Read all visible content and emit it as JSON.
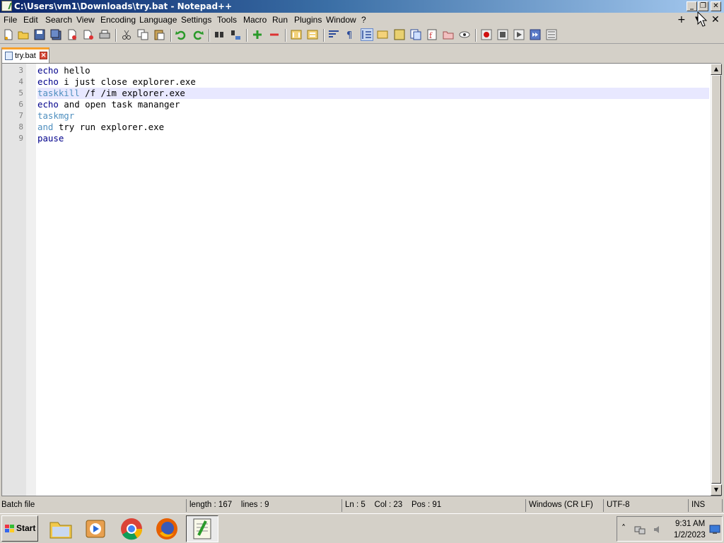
{
  "window": {
    "title": "C:\\Users\\vm1\\Downloads\\try.bat - Notepad++",
    "minimize_label": "_",
    "restore_label": "❐",
    "close_label": "✕"
  },
  "menu": {
    "items": [
      "File",
      "Edit",
      "Search",
      "View",
      "Encoding",
      "Language",
      "Settings",
      "Tools",
      "Macro",
      "Run",
      "Plugins",
      "Window",
      "?"
    ],
    "plus_label": "+",
    "dropdown_label": "▼",
    "close_label": "✕"
  },
  "tab": {
    "label": "try.bat",
    "close_label": "✕"
  },
  "editor": {
    "lines": [
      {
        "num": "3",
        "segments": [
          {
            "t": "echo",
            "c": "kw"
          },
          {
            "t": " hello",
            "c": ""
          }
        ]
      },
      {
        "num": "4",
        "segments": [
          {
            "t": "echo",
            "c": "kw"
          },
          {
            "t": " i just close explorer.exe",
            "c": ""
          }
        ]
      },
      {
        "num": "5",
        "current": true,
        "segments": [
          {
            "t": "taskkill",
            "c": "cmd"
          },
          {
            "t": " /f /im explorer.exe",
            "c": ""
          }
        ]
      },
      {
        "num": "6",
        "segments": [
          {
            "t": "echo",
            "c": "kw"
          },
          {
            "t": " and open task mananger",
            "c": ""
          }
        ]
      },
      {
        "num": "7",
        "segments": [
          {
            "t": "taskmgr",
            "c": "cmd"
          }
        ]
      },
      {
        "num": "8",
        "segments": [
          {
            "t": "and",
            "c": "cmd"
          },
          {
            "t": " try run explorer.exe",
            "c": ""
          }
        ]
      },
      {
        "num": "9",
        "segments": [
          {
            "t": "pause",
            "c": "kw"
          }
        ]
      }
    ]
  },
  "status": {
    "file_type": "Batch file",
    "length_lines": "length : 167    lines : 9",
    "position": "Ln : 5    Col : 23    Pos : 91",
    "eol": "Windows (CR LF)",
    "encoding": "UTF-8",
    "mode": "INS"
  },
  "taskbar": {
    "start_label": "Start",
    "apps": [
      "file-explorer",
      "media-player",
      "chrome",
      "firefox",
      "notepad-plus-plus"
    ],
    "tray_chevron": "˄",
    "clock_time": "9:31 AM",
    "clock_date": "1/2/2023"
  },
  "colors": {
    "keyword": "#00008b",
    "command": "#4f8fbf",
    "current_line": "#e8e8ff",
    "title_gradient_start": "#0a246a",
    "tab_accent": "#f9a12b"
  }
}
